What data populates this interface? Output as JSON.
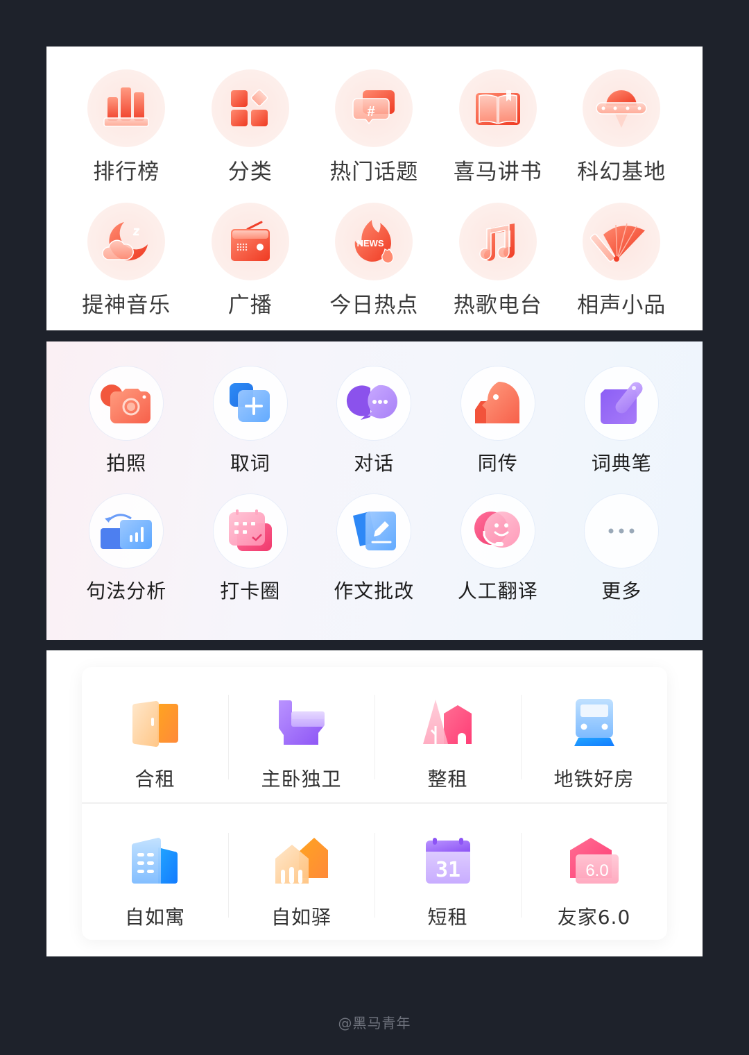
{
  "audio_menu": {
    "items": [
      {
        "label": "排行榜",
        "icon": "ranking-bars-icon"
      },
      {
        "label": "分类",
        "icon": "category-grid-icon"
      },
      {
        "label": "热门话题",
        "icon": "hashtag-chat-icon"
      },
      {
        "label": "喜马讲书",
        "icon": "open-book-icon"
      },
      {
        "label": "科幻基地",
        "icon": "ufo-icon"
      },
      {
        "label": "提神音乐",
        "icon": "moon-cloud-icon"
      },
      {
        "label": "广播",
        "icon": "radio-icon"
      },
      {
        "label": "今日热点",
        "icon": "news-flame-icon",
        "badge_text": "NEWS"
      },
      {
        "label": "热歌电台",
        "icon": "music-note-icon"
      },
      {
        "label": "相声小品",
        "icon": "folding-fan-icon"
      }
    ],
    "accent": "#f2533b"
  },
  "translate_menu": {
    "items": [
      {
        "label": "拍照",
        "icon": "camera-icon"
      },
      {
        "label": "取词",
        "icon": "add-word-icon"
      },
      {
        "label": "对话",
        "icon": "chat-bubbles-icon"
      },
      {
        "label": "同传",
        "icon": "parrot-head-icon"
      },
      {
        "label": "词典笔",
        "icon": "dictionary-pen-icon"
      },
      {
        "label": "句法分析",
        "icon": "syntax-chart-icon"
      },
      {
        "label": "打卡圈",
        "icon": "checkin-calendar-icon"
      },
      {
        "label": "作文批改",
        "icon": "essay-edit-icon"
      },
      {
        "label": "人工翻译",
        "icon": "human-translator-icon"
      },
      {
        "label": "更多",
        "icon": "more-dots-icon"
      }
    ]
  },
  "rent_menu": {
    "items": [
      {
        "label": "合租",
        "icon": "door-icon"
      },
      {
        "label": "主卧独卫",
        "icon": "toilet-icon"
      },
      {
        "label": "整租",
        "icon": "house-tree-icon"
      },
      {
        "label": "地铁好房",
        "icon": "subway-icon"
      },
      {
        "label": "自如寓",
        "icon": "apartment-building-icon"
      },
      {
        "label": "自如驿",
        "icon": "double-house-icon"
      },
      {
        "label": "短租",
        "icon": "calendar-31-icon",
        "badge_text": "31"
      },
      {
        "label": "友家6.0",
        "icon": "house-6-icon",
        "badge_text": "6.0"
      }
    ]
  },
  "footer": {
    "credit": "@黑马青年"
  }
}
